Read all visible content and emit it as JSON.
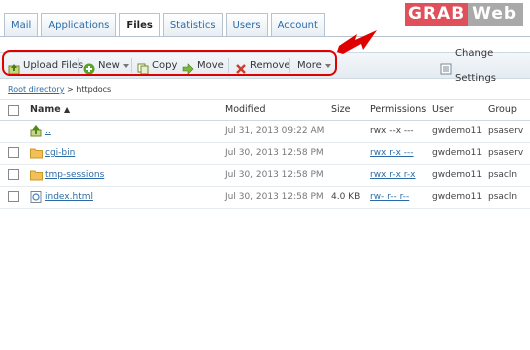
{
  "tabs": [
    {
      "label": "Mail",
      "active": false
    },
    {
      "label": "Applications",
      "active": false
    },
    {
      "label": "Files",
      "active": true
    },
    {
      "label": "Statistics",
      "active": false
    },
    {
      "label": "Users",
      "active": false
    },
    {
      "label": "Account",
      "active": false
    }
  ],
  "logo": {
    "part1": "GRAB",
    "part2": "Web"
  },
  "toolbar": {
    "upload": "Upload Files",
    "new": "New",
    "copy": "Copy",
    "move": "Move",
    "remove": "Remove",
    "more": "More",
    "change_settings": "Change Settings"
  },
  "breadcrumb": {
    "root": "Root directory",
    "separator": ">",
    "current": "httpdocs"
  },
  "table": {
    "headers": {
      "name": "Name",
      "modified": "Modified",
      "size": "Size",
      "permissions": "Permissions",
      "user": "User",
      "group": "Group"
    },
    "rows": [
      {
        "name": "..",
        "modified": "Jul 31, 2013 09:22 AM",
        "size": "",
        "permissions": "rwx --x ---",
        "user": "gwdemo11",
        "group": "psaserv",
        "type": "up"
      },
      {
        "name": "cgi-bin",
        "modified": "Jul 30, 2013 12:58 PM",
        "size": "",
        "permissions": "rwx r-x ---",
        "user": "gwdemo11",
        "group": "psaserv",
        "type": "folder"
      },
      {
        "name": "tmp-sessions",
        "modified": "Jul 30, 2013 12:58 PM",
        "size": "",
        "permissions": "rwx r-x r-x",
        "user": "gwdemo11",
        "group": "psacln",
        "type": "folder"
      },
      {
        "name": "index.html",
        "modified": "Jul 30, 2013 12:58 PM",
        "size": "4.0 KB",
        "permissions": "rw- r-- r--",
        "user": "gwdemo11",
        "group": "psacln",
        "type": "file"
      }
    ]
  },
  "colors": {
    "highlight": "#e00000",
    "link": "#2a6ba7",
    "logo_red": "#e0505a",
    "logo_gray": "#a9a9a9"
  }
}
